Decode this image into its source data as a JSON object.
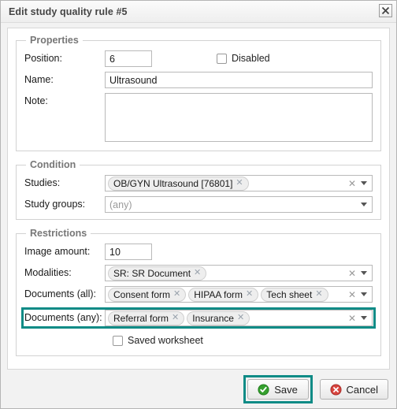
{
  "dialog": {
    "title": "Edit study quality rule #5",
    "close_icon": "close-icon"
  },
  "properties": {
    "legend": "Properties",
    "position_label": "Position:",
    "position_value": "6",
    "disabled_label": "Disabled",
    "disabled_checked": false,
    "name_label": "Name:",
    "name_value": "Ultrasound",
    "note_label": "Note:",
    "note_value": ""
  },
  "condition": {
    "legend": "Condition",
    "studies_label": "Studies:",
    "studies_tags": [
      "OB/GYN Ultrasound [76801]"
    ],
    "study_groups_label": "Study groups:",
    "study_groups_placeholder": "(any)",
    "study_groups_value": ""
  },
  "restrictions": {
    "legend": "Restrictions",
    "image_amount_label": "Image amount:",
    "image_amount_value": "10",
    "modalities_label": "Modalities:",
    "modalities_tags": [
      "SR: SR Document"
    ],
    "documents_all_label": "Documents (all):",
    "documents_all_tags": [
      "Consent form",
      "HIPAA form",
      "Tech sheet"
    ],
    "documents_any_label": "Documents (any):",
    "documents_any_tags": [
      "Referral form",
      "Insurance"
    ],
    "saved_worksheet_label": "Saved worksheet",
    "saved_worksheet_checked": false
  },
  "footer": {
    "save_label": "Save",
    "cancel_label": "Cancel"
  },
  "colors": {
    "highlight": "#0e8b86",
    "save_icon": "#35a02e",
    "cancel_icon": "#d8453f",
    "dialog_bg": "#f2f2f2"
  },
  "icons": {
    "tag_remove": "✕",
    "clear": "✕"
  }
}
